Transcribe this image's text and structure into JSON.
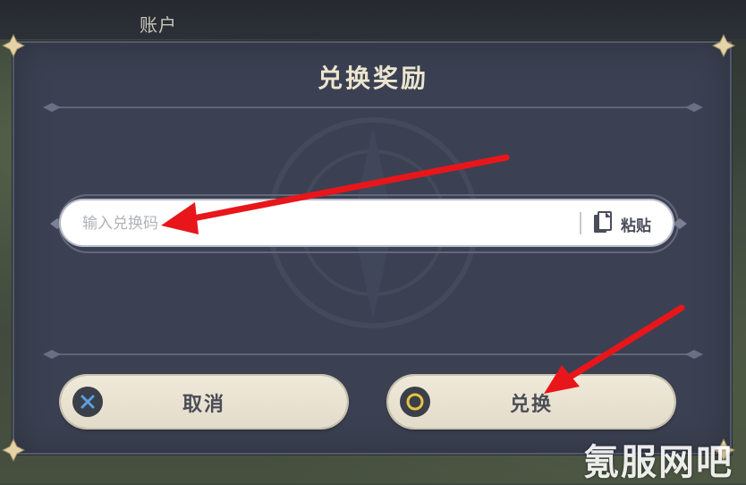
{
  "background": {
    "account_label": "账户"
  },
  "dialog": {
    "title": "兑换奖励",
    "code_input": {
      "placeholder": "输入兑换码",
      "value": ""
    },
    "paste_label": "粘贴",
    "cancel_label": "取消",
    "confirm_label": "兑换"
  },
  "watermark": {
    "text": "氪服网吧"
  },
  "colors": {
    "dialog_bg": "#3b4152",
    "title_text": "#ece5cf",
    "button_bg": "#efe9d9",
    "cancel_icon": "#5aa0e0",
    "confirm_icon": "#e8c343",
    "annotation_arrow": "#e8161a"
  },
  "icons": {
    "cancel": "x-circle-icon",
    "confirm": "o-circle-icon",
    "paste": "clipboard-icon"
  }
}
